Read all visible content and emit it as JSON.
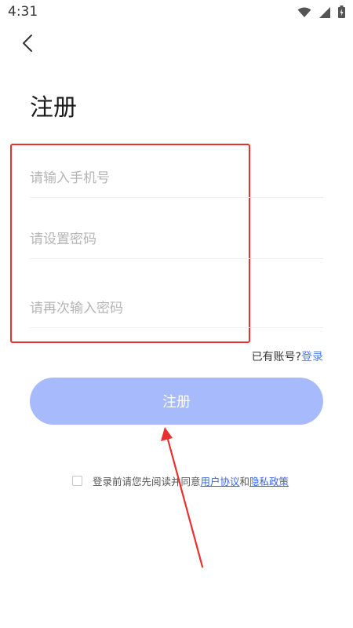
{
  "status_bar": {
    "time": "4:31"
  },
  "header": {
    "title": "注册"
  },
  "form": {
    "phone_placeholder": "请输入手机号",
    "password_placeholder": "请设置密码",
    "confirm_placeholder": "请再次输入密码"
  },
  "login_hint": {
    "text": "已有账号?",
    "link": "登录"
  },
  "register_button": {
    "label": "注册"
  },
  "agreement": {
    "prefix": "登录前请您先阅读并同意",
    "user_agreement": "用户协议",
    "and": "和",
    "privacy_policy": "隐私政策"
  },
  "colors": {
    "accent": "#4f7cf7",
    "button_disabled": "#a7bbfc",
    "highlight_red": "#e8312f"
  }
}
